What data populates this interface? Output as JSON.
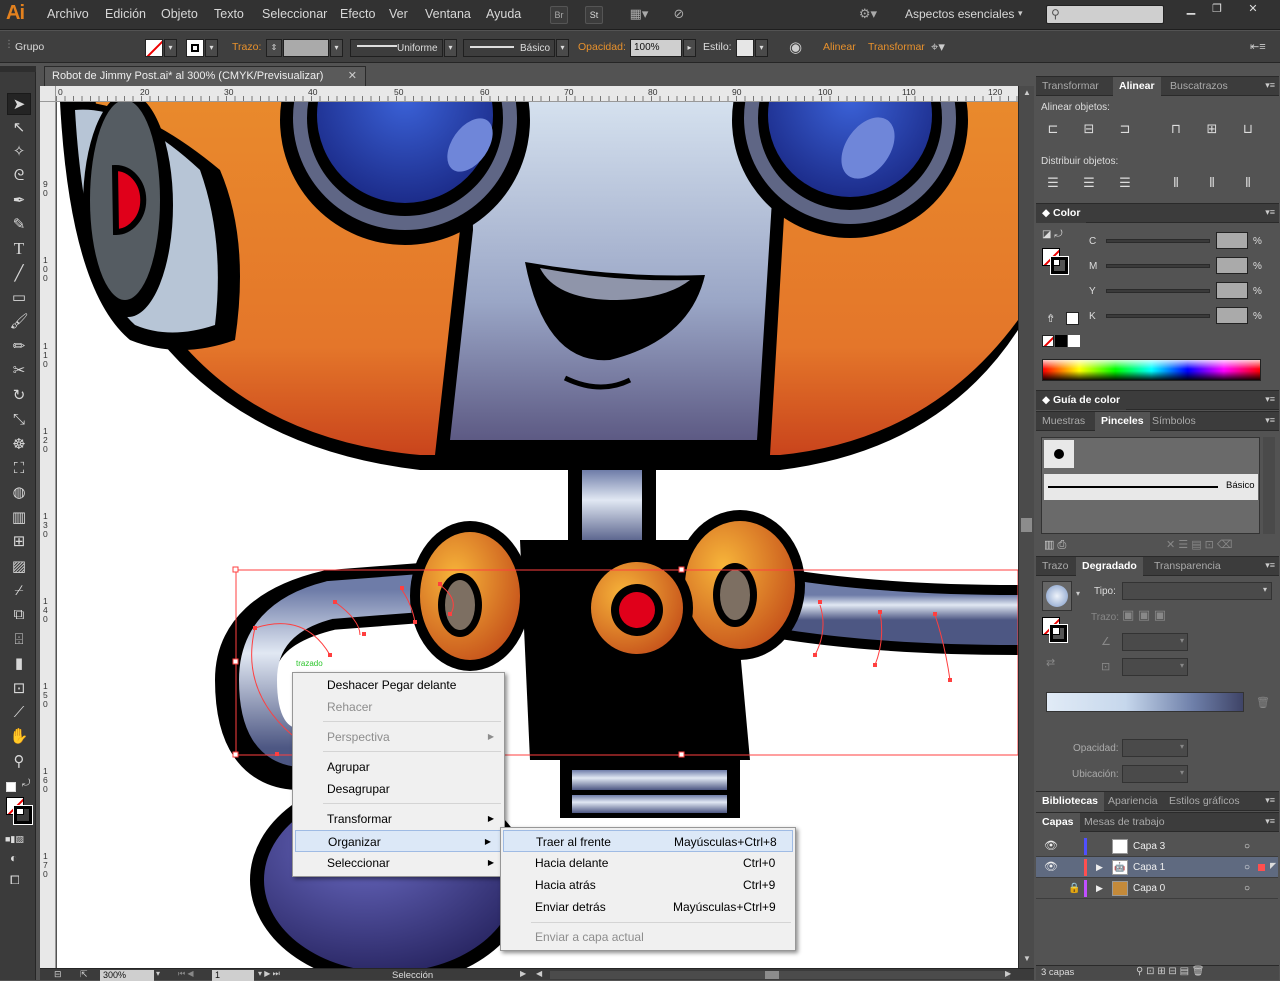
{
  "app": {
    "logo": "Ai"
  },
  "menubar": {
    "items": [
      "Archivo",
      "Edición",
      "Objeto",
      "Texto",
      "Seleccionar",
      "Efecto",
      "Ver",
      "Ventana",
      "Ayuda"
    ],
    "br_label": "Br",
    "st_label": "St",
    "workspace": "Aspectos esenciales",
    "search_placeholder": ""
  },
  "controlbar": {
    "group_label": "Grupo",
    "stroke_label": "Trazo:",
    "profile_uniform": "Uniforme",
    "brush_basic": "Básico",
    "opacity_label": "Opacidad:",
    "opacity_value": "100%",
    "style_label": "Estilo:",
    "align_label": "Alinear",
    "transform_label": "Transformar"
  },
  "document": {
    "tab_title": "Robot de Jimmy Post.ai* al 300% (CMYK/Previsualizar)",
    "close": "✕"
  },
  "rulers": {
    "h_ticks": [
      "0",
      "20",
      "30",
      "40",
      "50",
      "60",
      "70",
      "80",
      "90",
      "100",
      "110",
      "120"
    ],
    "v_ticks": [
      "9 0",
      "1 0 0",
      "1 1 0",
      "1 2 0",
      "1 3 0",
      "1 4 0",
      "1 5 0",
      "1 6 0",
      "1 7 0"
    ]
  },
  "canvas": {
    "hover_label": "trazado"
  },
  "statusbar": {
    "zoom": "300%",
    "page": "1",
    "tool": "Selección"
  },
  "context_menu": {
    "items": [
      {
        "label": "Deshacer Pegar delante",
        "disabled": false,
        "submenu": false
      },
      {
        "label": "Rehacer",
        "disabled": true,
        "submenu": false
      },
      {
        "label": "Perspectiva",
        "disabled": true,
        "submenu": true
      },
      {
        "label": "Agrupar",
        "disabled": false,
        "submenu": false
      },
      {
        "label": "Desagrupar",
        "disabled": false,
        "submenu": false
      },
      {
        "label": "Transformar",
        "disabled": false,
        "submenu": true
      },
      {
        "label": "Organizar",
        "disabled": false,
        "submenu": true,
        "highlighted": true
      },
      {
        "label": "Seleccionar",
        "disabled": false,
        "submenu": true
      }
    ]
  },
  "submenu": {
    "items": [
      {
        "label": "Traer al frente",
        "shortcut": "Mayúsculas+Ctrl+8",
        "highlighted": true
      },
      {
        "label": "Hacia delante",
        "shortcut": "Ctrl+0"
      },
      {
        "label": "Hacia atrás",
        "shortcut": "Ctrl+9"
      },
      {
        "label": "Enviar detrás",
        "shortcut": "Mayúsculas+Ctrl+9"
      },
      {
        "label": "Enviar a capa actual",
        "shortcut": "",
        "disabled": true
      }
    ]
  },
  "panels": {
    "align": {
      "tabs": [
        "Transformar",
        "Alinear",
        "Buscatrazos"
      ],
      "align_objects": "Alinear objetos:",
      "distribute_objects": "Distribuir objetos:"
    },
    "color": {
      "title": "Color",
      "channels": [
        "C",
        "M",
        "Y",
        "K"
      ],
      "percent": "%"
    },
    "color_guide": {
      "title": "Guía de color"
    },
    "brushes": {
      "tabs": [
        "Muestras",
        "Pinceles",
        "Símbolos"
      ],
      "basic": "Básico"
    },
    "gradient": {
      "tabs": [
        "Trazo",
        "Degradado",
        "Transparencia"
      ],
      "type_label": "Tipo:",
      "stroke_label": "Trazo:",
      "opacity_label": "Opacidad:",
      "location_label": "Ubicación:"
    },
    "libraries": {
      "tabs": [
        "Bibliotecas",
        "Apariencia",
        "Estilos gráficos"
      ]
    },
    "layers": {
      "tabs": [
        "Capas",
        "Mesas de trabajo"
      ],
      "rows": [
        {
          "name": "Capa 3",
          "color": "#4f4fff"
        },
        {
          "name": "Capa 1",
          "color": "#ff4f4f"
        },
        {
          "name": "Capa 0",
          "color": "#c04fff"
        }
      ],
      "count": "3 capas"
    }
  },
  "colors": {
    "accent_orange": "#e8912c",
    "menu_highlight": "#dce8f7",
    "selection_red": "#ff3f3f"
  }
}
